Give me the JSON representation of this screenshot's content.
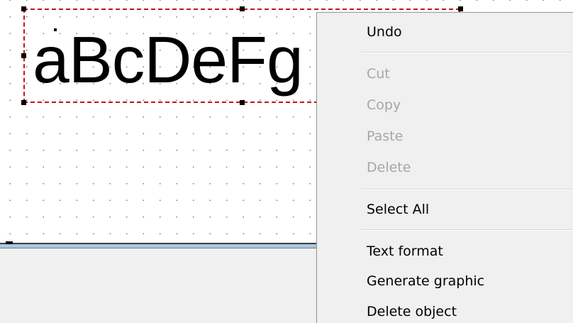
{
  "canvas": {
    "text_object": {
      "content": "aBcDeFg"
    }
  },
  "context_menu": {
    "items": [
      {
        "label": "Undo",
        "enabled": true
      },
      {
        "label": "Cut",
        "enabled": false
      },
      {
        "label": "Copy",
        "enabled": false
      },
      {
        "label": "Paste",
        "enabled": false
      },
      {
        "label": "Delete",
        "enabled": false
      },
      {
        "label": "Select All",
        "enabled": true
      },
      {
        "label": "Text format",
        "enabled": true
      },
      {
        "label": "Generate graphic",
        "enabled": true
      },
      {
        "label": "Delete object",
        "enabled": true
      }
    ]
  },
  "colors": {
    "selection_border": "#c41414",
    "menu_background": "#f0f0f0",
    "disabled_text": "#a6a6a6",
    "canvas_edge_blue": "#a9c8e6"
  }
}
